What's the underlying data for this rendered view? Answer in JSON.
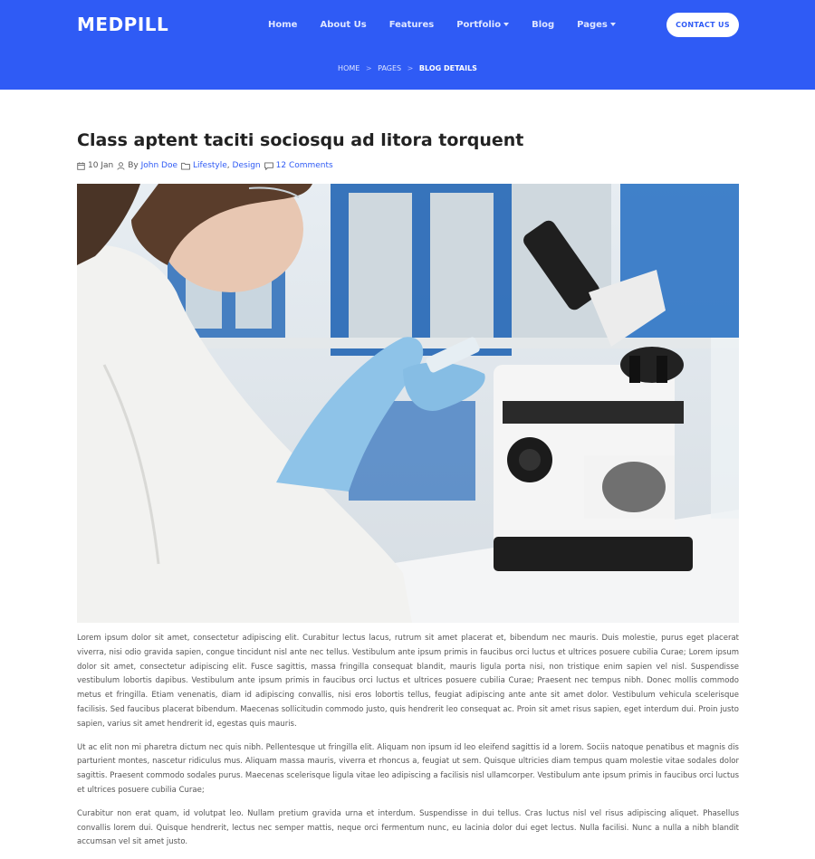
{
  "brand": {
    "name": "MEDPILL"
  },
  "nav": {
    "items": [
      {
        "label": "Home",
        "dropdown": false
      },
      {
        "label": "About Us",
        "dropdown": false
      },
      {
        "label": "Features",
        "dropdown": false
      },
      {
        "label": "Portfolio",
        "dropdown": true
      },
      {
        "label": "Blog",
        "dropdown": false
      },
      {
        "label": "Pages",
        "dropdown": true
      }
    ],
    "cta_label": "CONTACT US"
  },
  "breadcrumb": {
    "items": [
      "HOME",
      "PAGES"
    ],
    "current": "BLOG DETAILS",
    "separator": ">"
  },
  "post": {
    "title": "Class aptent taciti sociosqu ad litora torquent",
    "date": "10 Jan",
    "by_prefix": "By",
    "author": "John Doe",
    "categories": [
      "Lifestyle",
      "Design"
    ],
    "category_separator": ",",
    "comments": "12 Comments",
    "paragraphs": [
      "Lorem ipsum dolor sit amet, consectetur adipiscing elit. Curabitur lectus lacus, rutrum sit amet placerat et, bibendum nec mauris. Duis molestie, purus eget placerat viverra, nisi odio gravida sapien, congue tincidunt nisl ante nec tellus. Vestibulum ante ipsum primis in faucibus orci luctus et ultrices posuere cubilia Curae; Lorem ipsum dolor sit amet, consectetur adipiscing elit. Fusce sagittis, massa fringilla consequat blandit, mauris ligula porta nisi, non tristique enim sapien vel nisl. Suspendisse vestibulum lobortis dapibus. Vestibulum ante ipsum primis in faucibus orci luctus et ultrices posuere cubilia Curae; Praesent nec tempus nibh. Donec mollis commodo metus et fringilla. Etiam venenatis, diam id adipiscing convallis, nisi eros lobortis tellus, feugiat adipiscing ante ante sit amet dolor. Vestibulum vehicula scelerisque facilisis. Sed faucibus placerat bibendum. Maecenas sollicitudin commodo justo, quis hendrerit leo consequat ac. Proin sit amet risus sapien, eget interdum dui. Proin justo sapien, varius sit amet hendrerit id, egestas quis mauris.",
      "Ut ac elit non mi pharetra dictum nec quis nibh. Pellentesque ut fringilla elit. Aliquam non ipsum id leo eleifend sagittis id a lorem. Sociis natoque penatibus et magnis dis parturient montes, nascetur ridiculus mus. Aliquam massa mauris, viverra et rhoncus a, feugiat ut sem. Quisque ultricies diam tempus quam molestie vitae sodales dolor sagittis. Praesent commodo sodales purus. Maecenas scelerisque ligula vitae leo adipiscing a facilisis nisl ullamcorper. Vestibulum ante ipsum primis in faucibus orci luctus et ultrices posuere cubilia Curae;",
      "Curabitur non erat quam, id volutpat leo. Nullam pretium gravida urna et interdum. Suspendisse in dui tellus. Cras luctus nisl vel risus adipiscing aliquet. Phasellus convallis lorem dui. Quisque hendrerit, lectus nec semper mattis, neque orci fermentum nunc, eu lacinia dolor dui eget lectus. Nulla facilisi. Nunc a nulla a nibh blandit accumsan vel sit amet justo."
    ]
  },
  "colors": {
    "primary": "#2f5bf5",
    "link": "#2f5bf5",
    "text": "#555555",
    "heading": "#222222"
  },
  "icons": {
    "date": "calendar-icon",
    "author": "user-icon",
    "category": "folder-icon",
    "comments": "comment-icon"
  }
}
